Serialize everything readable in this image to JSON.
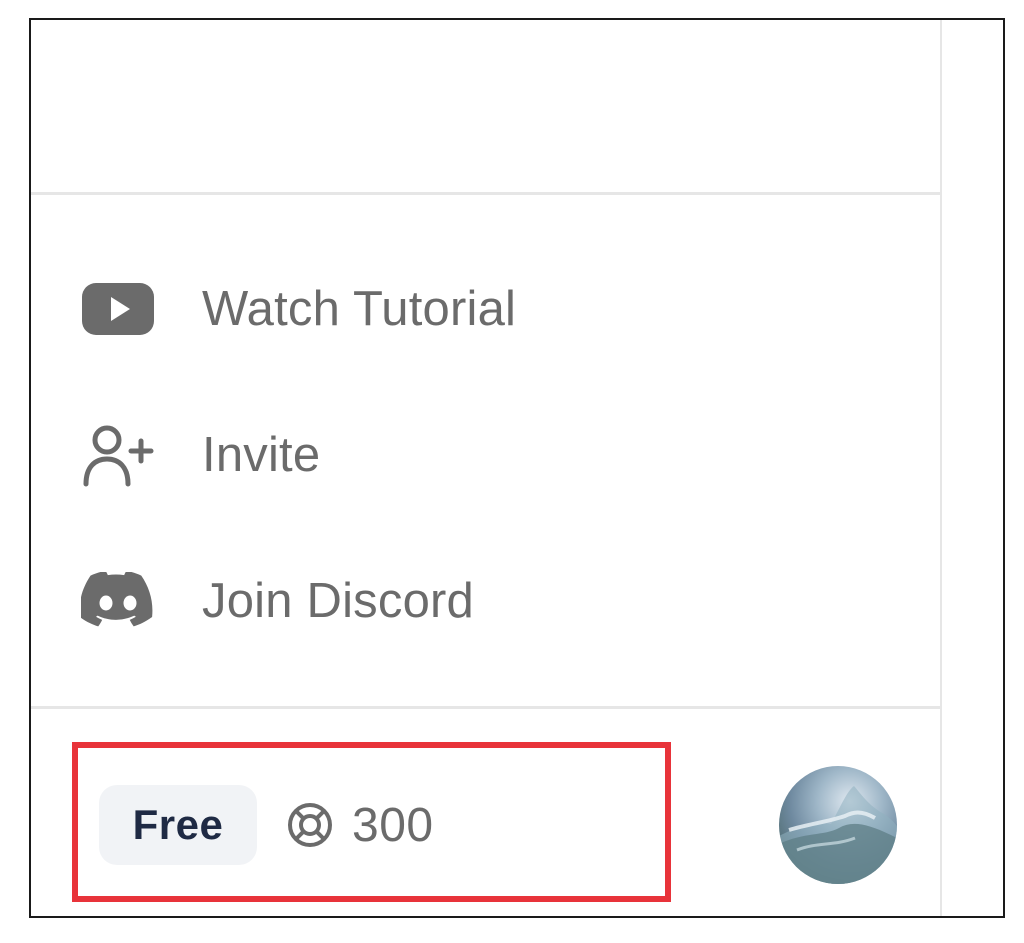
{
  "menu": {
    "items": [
      {
        "label": "Watch Tutorial",
        "icon": "youtube-icon"
      },
      {
        "label": "Invite",
        "icon": "user-plus-icon"
      },
      {
        "label": "Join Discord",
        "icon": "discord-icon"
      }
    ]
  },
  "footer": {
    "plan_label": "Free",
    "credits_icon": "lifebuoy-icon",
    "credits_value": "300",
    "avatar": "user-avatar"
  },
  "colors": {
    "menu_text": "#6b6b6b",
    "icon": "#6b6b6b",
    "plan_badge_bg": "#f1f3f6",
    "plan_text": "#1f2a44",
    "highlight": "#e8333a",
    "divider": "#e6e6e6"
  }
}
